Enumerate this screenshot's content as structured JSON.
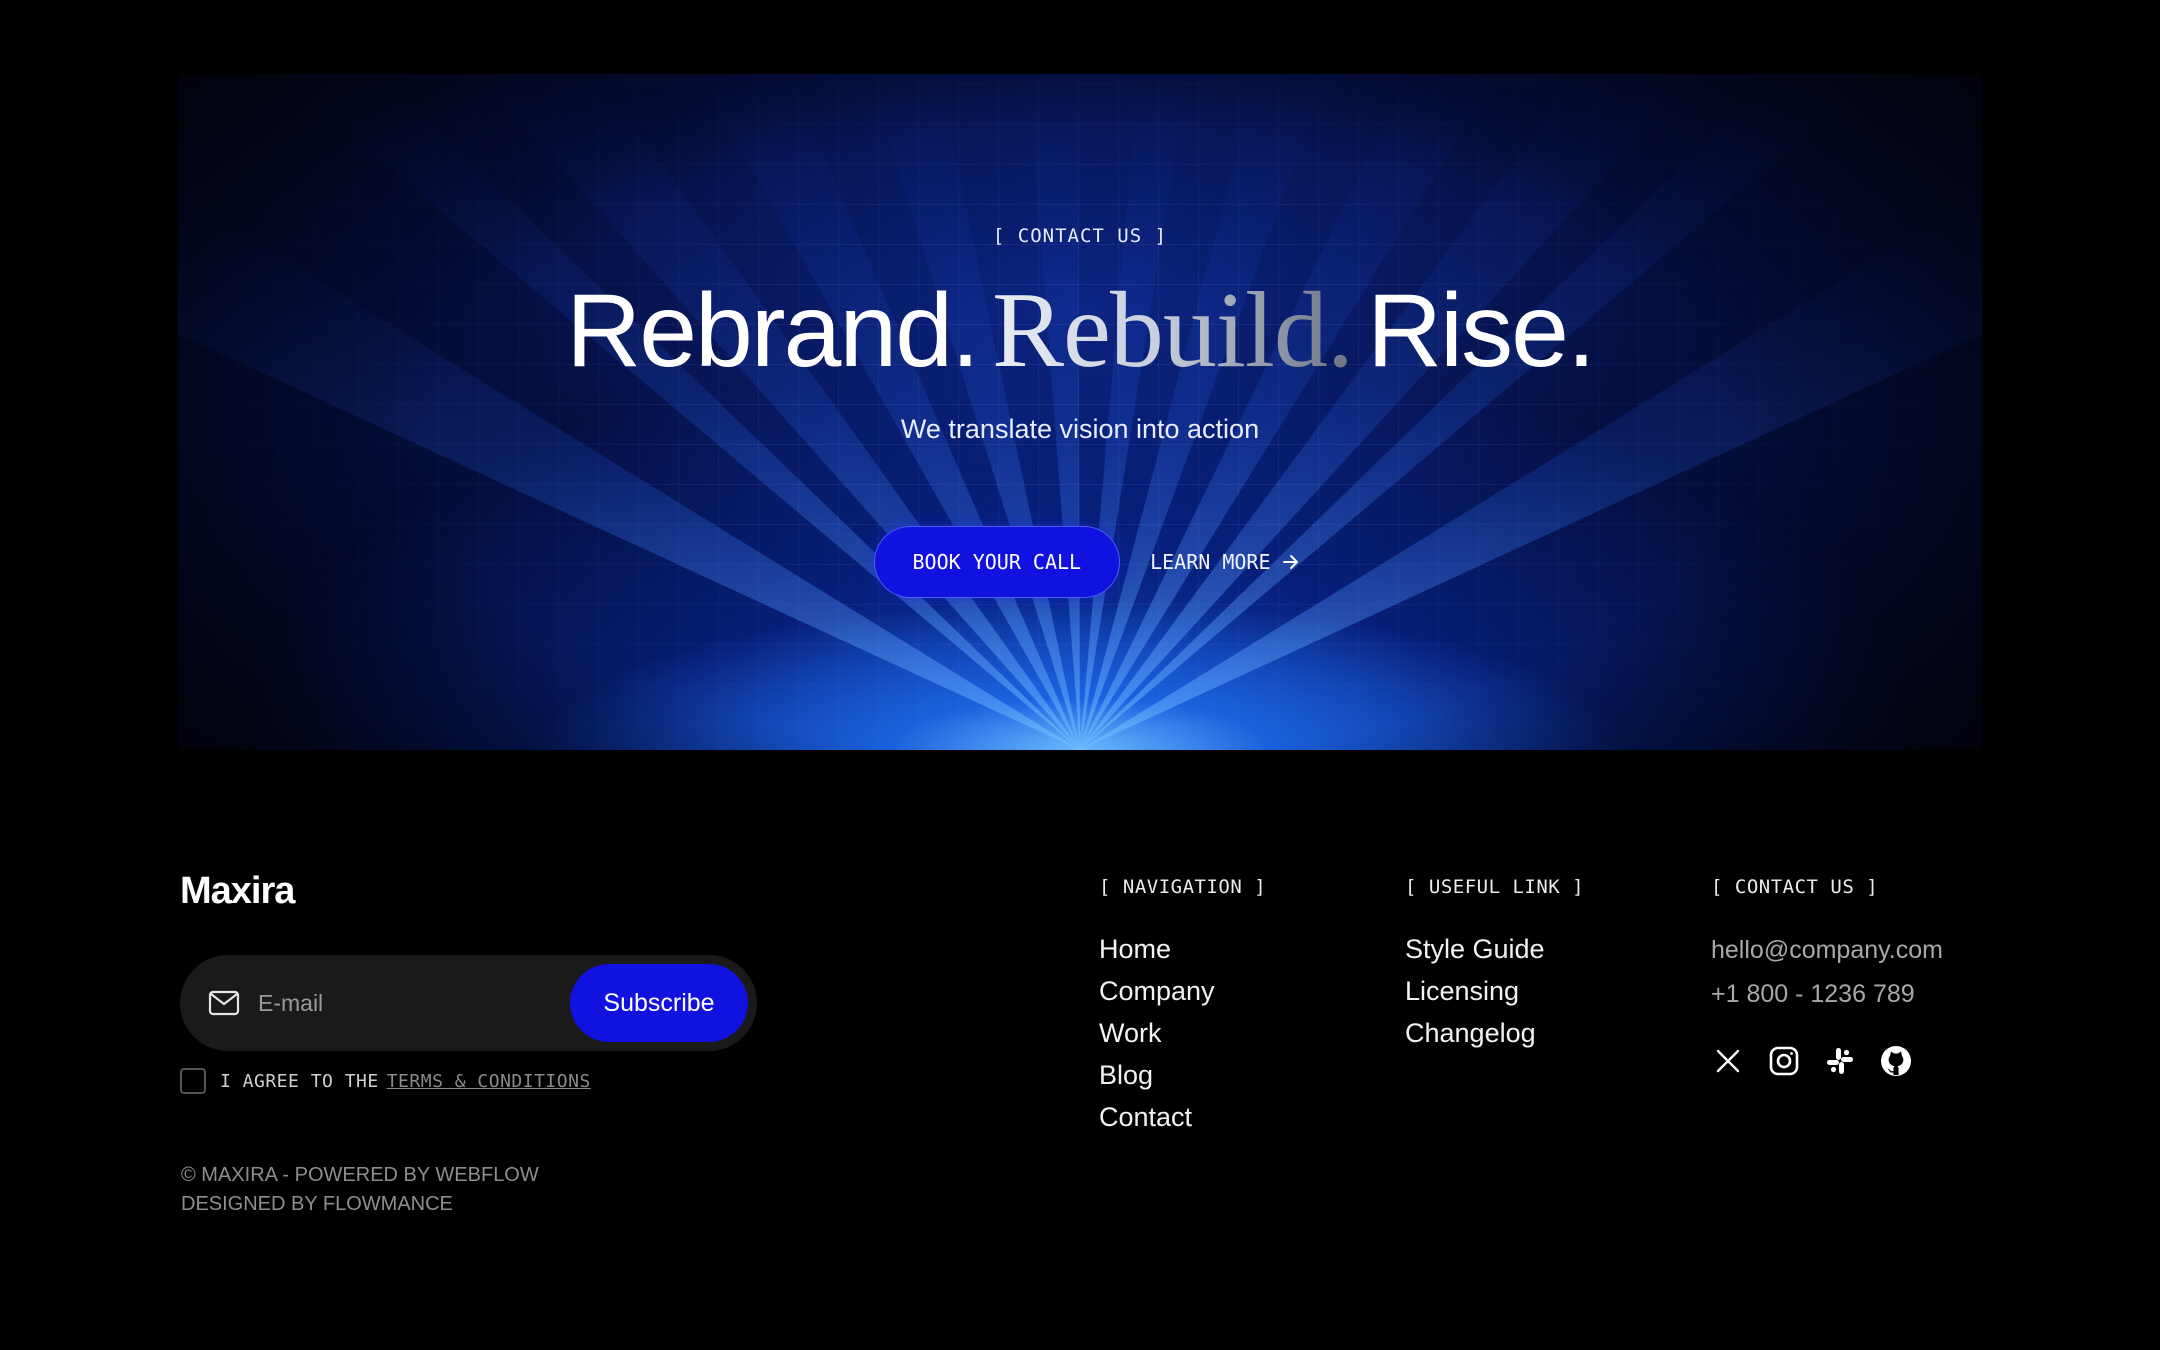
{
  "hero": {
    "eyebrow": "[ CONTACT US ]",
    "headline": {
      "word1": "Rebrand.",
      "word2": "Rebuild.",
      "word3": "Rise."
    },
    "subtitle": "We translate vision into action",
    "primary_cta": "BOOK YOUR CALL",
    "secondary_cta": "LEARN MORE",
    "accent_color": "#1111e0"
  },
  "footer": {
    "logo": "Maxira",
    "newsletter": {
      "email_placeholder": "E-mail",
      "subscribe_label": "Subscribe"
    },
    "agree": {
      "text": "I AGREE TO THE",
      "link": "TERMS & CONDITIONS"
    },
    "copyright": {
      "line1": "© MAXIRA - POWERED BY WEBFLOW",
      "line2": "DESIGNED BY FLOWMANCE"
    },
    "navigation": {
      "title": "[ NAVIGATION ]",
      "items": [
        "Home",
        "Company",
        "Work",
        "Blog",
        "Contact"
      ]
    },
    "useful_links": {
      "title": "[ USEFUL LINK ]",
      "items": [
        "Style Guide",
        "Licensing",
        "Changelog"
      ]
    },
    "contact": {
      "title": "[ CONTACT US ]",
      "email": "hello@company.com",
      "phone": "+1 800 - 1236 789",
      "socials": [
        "x-icon",
        "instagram-icon",
        "slack-icon",
        "github-icon"
      ]
    }
  }
}
